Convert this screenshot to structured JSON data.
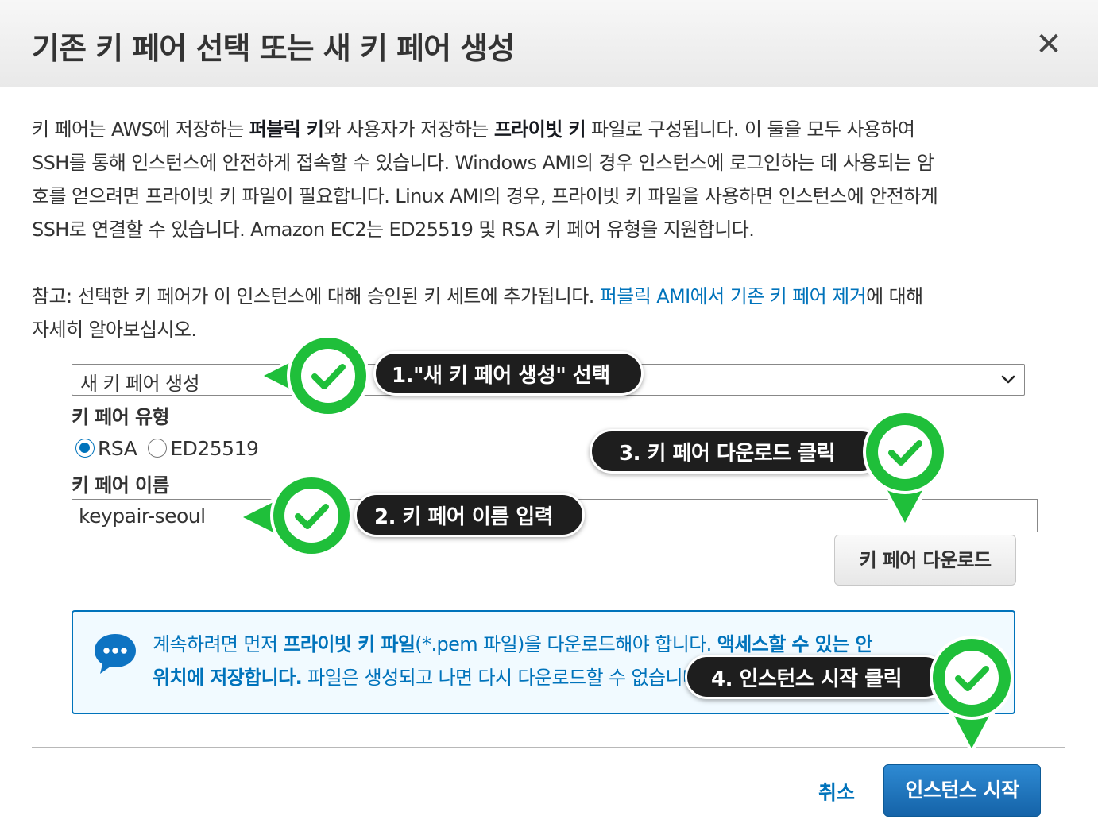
{
  "dialog": {
    "title": "기존 키 페어 선택 또는 새 키 페어 생성",
    "close_label": "✕"
  },
  "intro": {
    "line1_a": "키 페어는 AWS에 저장하는 ",
    "line1_b": "퍼블릭 키",
    "line1_c": "와 사용자가 저장하는 ",
    "line1_d": "프라이빗 키",
    "line1_e": " 파일로 구성됩니다. 이 둘을 모두 사용하여",
    "line2": "SSH를 통해 인스턴스에 안전하게 접속할 수 있습니다. Windows AMI의 경우 인스턴스에 로그인하는 데 사용되는 암",
    "line3": "호를 얻으려면 프라이빗 키 파일이 필요합니다. Linux AMI의 경우, 프라이빗 키 파일을 사용하면 인스턴스에 안전하게",
    "line4": "SSH로 연결할 수 있습니다. Amazon EC2는 ED25519 및 RSA 키 페어 유형을 지원합니다."
  },
  "note": {
    "line1_a": "참고: 선택한 키 페어가 이 인스턴스에 대해 승인된 키 세트에 추가됩니다. ",
    "link": "퍼블릭 AMI에서 기존 키 페어 제거",
    "line1_b": "에 대해",
    "line2": "자세히 알아보십시오."
  },
  "key_pair_select": {
    "value": "새 키 페어 생성"
  },
  "key_type": {
    "label": "키 페어 유형",
    "options": [
      {
        "label": "RSA",
        "selected": true
      },
      {
        "label": "ED25519",
        "selected": false
      }
    ]
  },
  "key_name": {
    "label": "키 페어 이름",
    "value": "keypair-seoul"
  },
  "download_button": "키 페어 다운로드",
  "info": {
    "line1_a": "계속하려면 먼저 ",
    "line1_b": "프라이빗 키 파일",
    "line1_c": "(*.pem 파일)을 다운로드해야 합니다. ",
    "line1_d": "액세스할 수 있는 안",
    "line2_a": "위치에 저장합니다.",
    "line2_b": " 파일은 생성되고 나면 다시 다운로드할 수 없습니다."
  },
  "footer": {
    "cancel": "취소",
    "launch": "인스턴스 시작"
  },
  "callouts": {
    "step1": "1.\"새 키 페어 생성\" 선택",
    "step2": "2. 키 페어 이름 입력",
    "step3": "3. 키 페어 다운로드 클릭",
    "step4": "4. 인스턴스 시작 클릭"
  },
  "colors": {
    "link_blue": "#0073bb",
    "callout_green": "#1fbf3a",
    "callout_dark": "#1e1e1e",
    "info_bg": "#f1faff"
  }
}
